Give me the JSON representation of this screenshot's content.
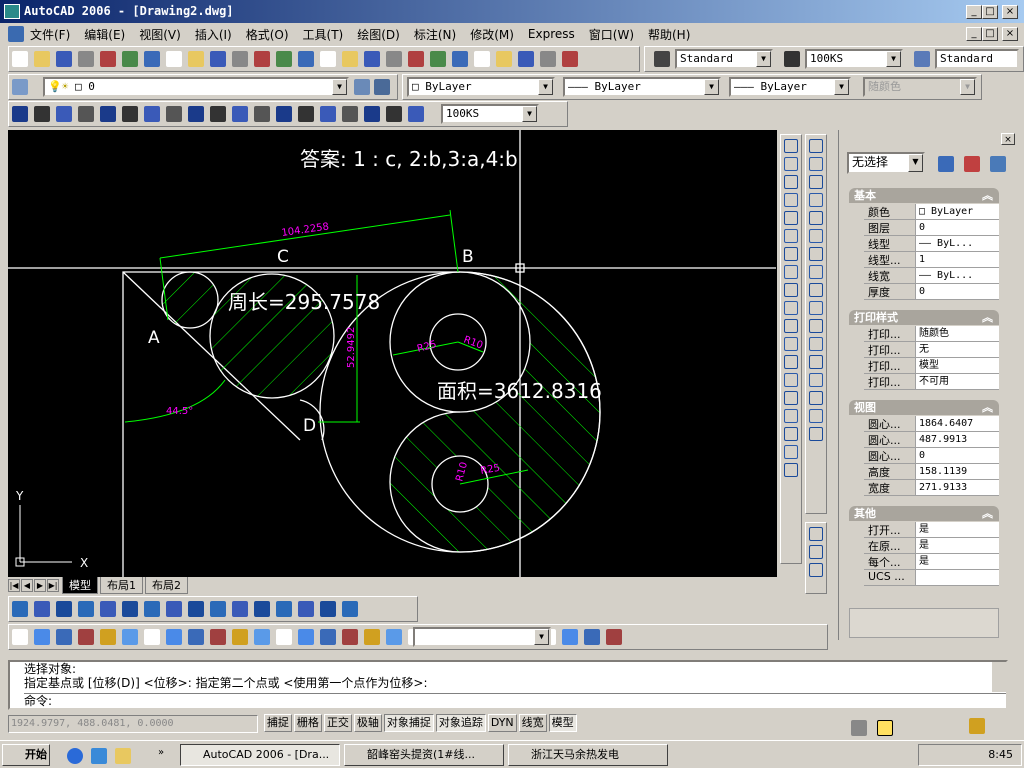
{
  "window": {
    "title": "AutoCAD 2006 - [Drawing2.dwg]"
  },
  "menu": [
    "文件(F)",
    "编辑(E)",
    "视图(V)",
    "插入(I)",
    "格式(O)",
    "工具(T)",
    "绘图(D)",
    "标注(N)",
    "修改(M)",
    "Express",
    "窗口(W)",
    "帮助(H)"
  ],
  "toolbars": {
    "text_style": "Standard",
    "dim_style": "100KS",
    "table_style": "Standard",
    "layer": "0",
    "color": "ByLayer",
    "linetype": "ByLayer",
    "lineweight": "ByLayer",
    "plotstyle": "随颜色",
    "dim_style2": "100KS",
    "workspace": ""
  },
  "drawing": {
    "answer": "答案: 1 : c, 2:b,3:a,4:b",
    "dim_length": "104.2258",
    "dim_vertical": "52.9492",
    "dim_angle": "44.5°",
    "perimeter": "周长=295.7578",
    "area": "面积=3612.8316",
    "labels": {
      "a": "A",
      "b": "B",
      "c": "C",
      "d": "D"
    },
    "r25_top": "R25",
    "r10_top": "R10",
    "r10_bottom": "R10",
    "r25_bottom": "R25",
    "ucs_x": "X",
    "ucs_y": "Y"
  },
  "layout_tabs": [
    "模型",
    "布局1",
    "布局2"
  ],
  "properties": {
    "selection": "无选择",
    "sections": [
      {
        "title": "基本",
        "rows": [
          [
            "颜色",
            "□ ByLayer"
          ],
          [
            "图层",
            "0"
          ],
          [
            "线型",
            "—— ByL..."
          ],
          [
            "线型...",
            "1"
          ],
          [
            "线宽",
            "—— ByL..."
          ],
          [
            "厚度",
            "0"
          ]
        ]
      },
      {
        "title": "打印样式",
        "rows": [
          [
            "打印...",
            "随颜色"
          ],
          [
            "打印...",
            "无"
          ],
          [
            "打印...",
            "模型"
          ],
          [
            "打印...",
            "不可用"
          ]
        ]
      },
      {
        "title": "视图",
        "rows": [
          [
            "圆心...",
            "1864.6407"
          ],
          [
            "圆心...",
            "487.9913"
          ],
          [
            "圆心...",
            "0"
          ],
          [
            "高度",
            "158.1139"
          ],
          [
            "宽度",
            "271.9133"
          ]
        ]
      },
      {
        "title": "其他",
        "rows": [
          [
            "打开...",
            "是"
          ],
          [
            "在原...",
            "是"
          ],
          [
            "每个...",
            "是"
          ],
          [
            "UCS ...",
            ""
          ]
        ]
      }
    ]
  },
  "command": {
    "lines": [
      "选择对象:",
      "指定基点或 [位移(D)] <位移>:  指定第二个点或 <使用第一个点作为位移>:"
    ],
    "prompt": "命令:"
  },
  "status": {
    "coords": "1924.9797, 488.0481, 0.0000",
    "toggles": [
      {
        "label": "捕捉",
        "on": false
      },
      {
        "label": "栅格",
        "on": false
      },
      {
        "label": "正交",
        "on": false
      },
      {
        "label": "极轴",
        "on": false
      },
      {
        "label": "对象捕捉",
        "on": true
      },
      {
        "label": "对象追踪",
        "on": true
      },
      {
        "label": "DYN",
        "on": false
      },
      {
        "label": "线宽",
        "on": false
      },
      {
        "label": "模型",
        "on": true
      }
    ]
  },
  "taskbar": {
    "start": "开始",
    "tasks": [
      "AutoCAD 2006 - [Dra...",
      "韶峰窑头提资(1#线...",
      "浙江天马余热发电"
    ],
    "clock": "8:45"
  },
  "colors": {
    "hatch": "#00ff00",
    "dimension": "#00ff00",
    "dim_text": "#ff00ff",
    "geometry": "#ffffff",
    "background": "#000000"
  }
}
